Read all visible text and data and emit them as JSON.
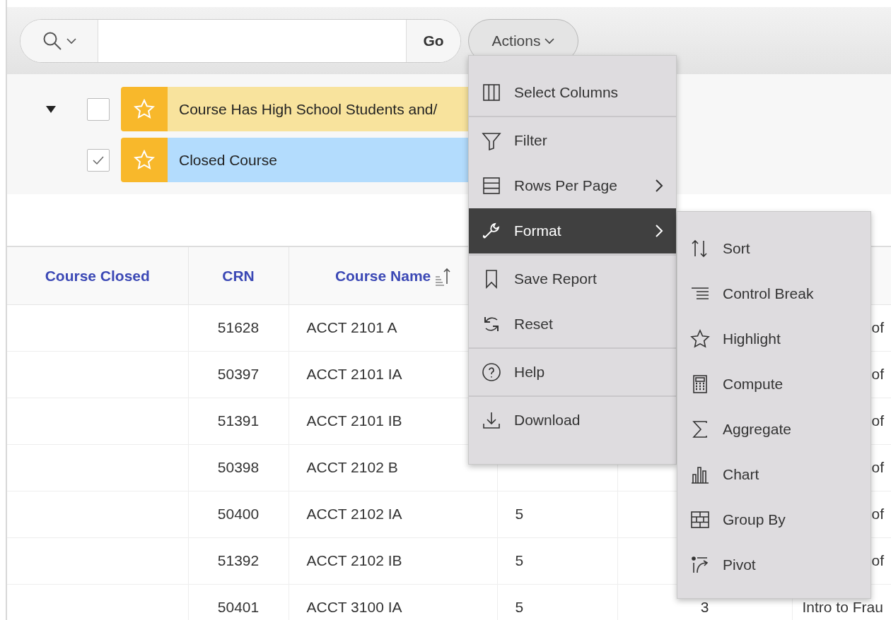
{
  "search": {
    "go_label": "Go"
  },
  "actions_button": {
    "label": "Actions",
    "expanded": true
  },
  "filters": {
    "expanded": true,
    "items": [
      {
        "label": "Course Has High School Students and/",
        "checked": false,
        "color": "#f8e39d"
      },
      {
        "label": "Closed Course",
        "checked": true,
        "color": "#b3dcfd"
      }
    ]
  },
  "table": {
    "columns": [
      {
        "label": "Course Closed",
        "sorted": false
      },
      {
        "label": "CRN",
        "sorted": false
      },
      {
        "label": "Course Name",
        "sorted": true
      }
    ],
    "rows": [
      {
        "crn": "51628",
        "course_name": "ACCT 2101 A",
        "column_6": "of"
      },
      {
        "crn": "50397",
        "course_name": "ACCT 2101 IA",
        "column_6": "of"
      },
      {
        "crn": "51391",
        "course_name": "ACCT 2101 IB",
        "column_6": "of"
      },
      {
        "crn": "50398",
        "course_name": "ACCT 2102 B",
        "column_6": "of"
      },
      {
        "crn": "50400",
        "course_name": "ACCT 2102 IA",
        "column_4": "5",
        "column_6": "of"
      },
      {
        "crn": "51392",
        "course_name": "ACCT 2102 IB",
        "column_4": "5",
        "column_6": "of"
      },
      {
        "crn": "50401",
        "course_name": "ACCT 3100 IA",
        "column_4": "5",
        "column_5": "3",
        "column_6": "Intro to Frau"
      }
    ]
  },
  "actions_menu": {
    "groups": [
      [
        {
          "label": "Select Columns",
          "has_submenu": false,
          "selected": false
        }
      ],
      [
        {
          "label": "Filter",
          "has_submenu": false,
          "selected": false
        },
        {
          "label": "Rows Per Page",
          "has_submenu": true,
          "selected": false
        },
        {
          "label": "Format",
          "has_submenu": true,
          "selected": true
        }
      ],
      [
        {
          "label": "Save Report",
          "has_submenu": false,
          "selected": false
        },
        {
          "label": "Reset",
          "has_submenu": false,
          "selected": false
        }
      ],
      [
        {
          "label": "Help",
          "has_submenu": false,
          "selected": false
        }
      ],
      [
        {
          "label": "Download",
          "has_submenu": false,
          "selected": false
        }
      ]
    ]
  },
  "format_submenu": {
    "items": [
      {
        "label": "Sort"
      },
      {
        "label": "Control Break"
      },
      {
        "label": "Highlight"
      },
      {
        "label": "Compute"
      },
      {
        "label": "Aggregate"
      },
      {
        "label": "Chart"
      },
      {
        "label": "Group By"
      },
      {
        "label": "Pivot"
      }
    ]
  }
}
